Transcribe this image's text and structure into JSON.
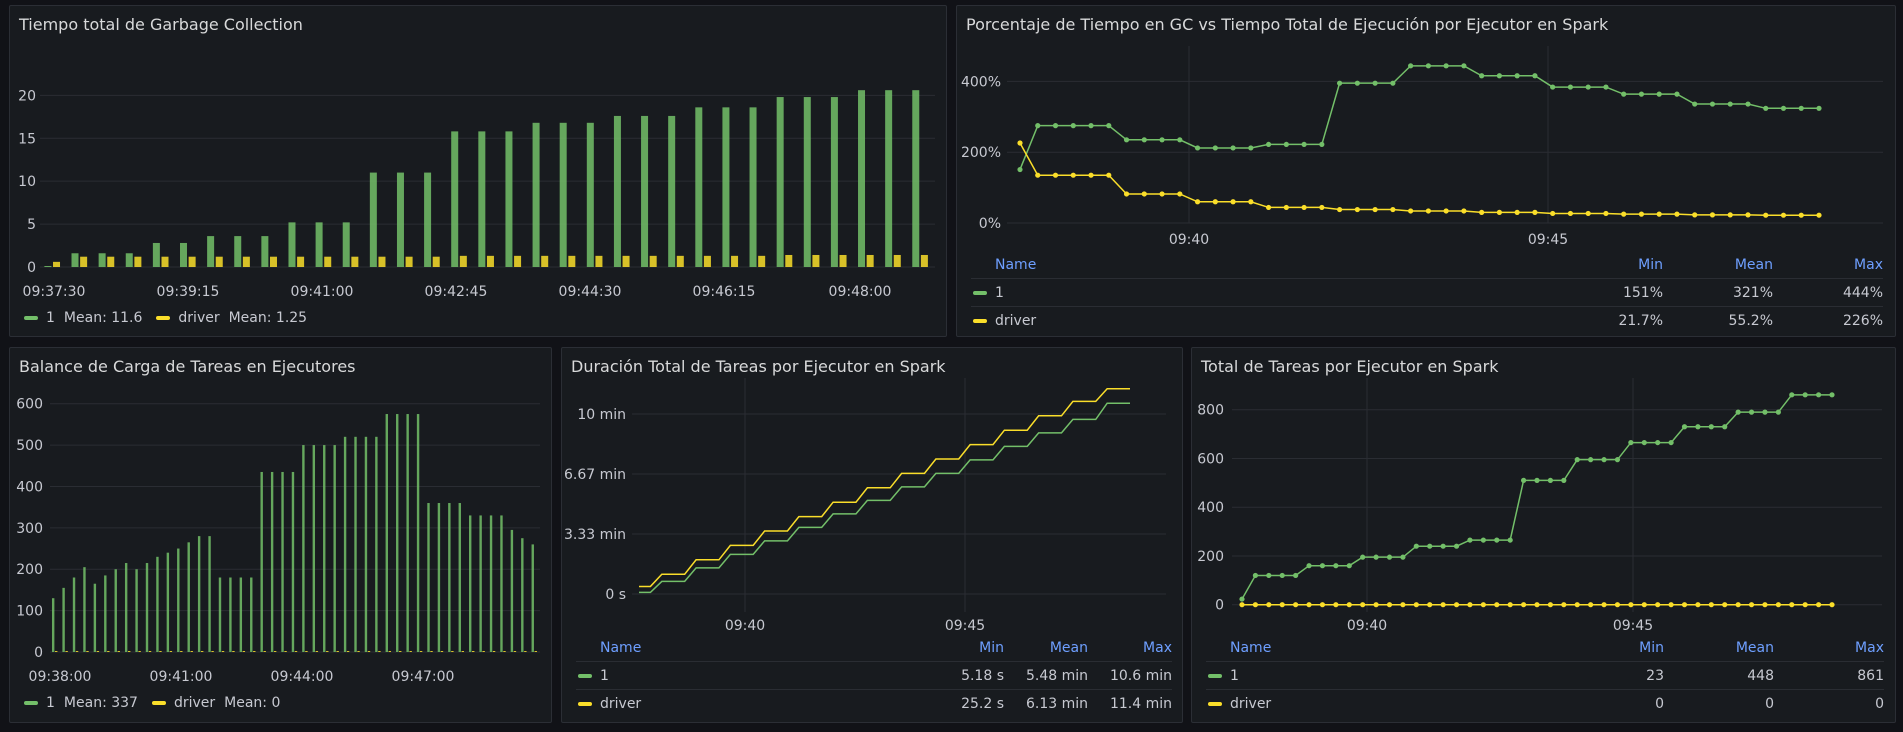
{
  "colors": {
    "green": "#73bf69",
    "yellow": "#fade2a",
    "axis_text": "#c7c9d1",
    "link_blue": "#6e9fff"
  },
  "panels": {
    "gc_time": {
      "title": "Tiempo total de Garbage Collection",
      "legend": [
        {
          "name": "1",
          "label": "Mean: 11.6",
          "color": "#73bf69"
        },
        {
          "name": "driver",
          "label": "Mean: 1.25",
          "color": "#fade2a"
        }
      ],
      "chart_data": {
        "type": "bar",
        "x_ticks": [
          "09:37:30",
          "09:39:15",
          "09:41:00",
          "09:42:45",
          "09:44:30",
          "09:46:15",
          "09:48:00"
        ],
        "y_ticks": [
          "0",
          "5",
          "10",
          "15",
          "20"
        ],
        "ylim": [
          0,
          24
        ],
        "series": [
          {
            "name": "1",
            "values": [
              0.1,
              1.6,
              1.6,
              1.6,
              2.8,
              2.8,
              3.6,
              3.6,
              3.6,
              5.2,
              5.2,
              5.2,
              11,
              11,
              11,
              15.8,
              15.8,
              15.8,
              16.8,
              16.8,
              16.8,
              17.6,
              17.6,
              17.6,
              18.6,
              18.6,
              18.6,
              19.8,
              19.8,
              19.8,
              20.6,
              20.6,
              20.6
            ]
          },
          {
            "name": "driver",
            "values": [
              0.6,
              1.2,
              1.2,
              1.2,
              1.2,
              1.2,
              1.2,
              1.2,
              1.2,
              1.2,
              1.2,
              1.2,
              1.2,
              1.2,
              1.2,
              1.3,
              1.3,
              1.3,
              1.3,
              1.3,
              1.3,
              1.3,
              1.3,
              1.3,
              1.3,
              1.3,
              1.3,
              1.4,
              1.4,
              1.4,
              1.4,
              1.4,
              1.4
            ]
          }
        ]
      }
    },
    "gc_percent": {
      "title": "Porcentaje de Tiempo en GC vs Tiempo Total de Ejecución por Ejecutor en Spark",
      "table_headers": {
        "name": "Name",
        "min": "Min",
        "mean": "Mean",
        "max": "Max"
      },
      "rows": [
        {
          "name": "1",
          "min": "151%",
          "mean": "321%",
          "max": "444%",
          "color": "#73bf69"
        },
        {
          "name": "driver",
          "min": "21.7%",
          "mean": "55.2%",
          "max": "226%",
          "color": "#fade2a"
        }
      ],
      "chart_data": {
        "type": "line",
        "x_ticks": [
          "09:40",
          "09:45"
        ],
        "y_ticks": [
          "0%",
          "200%",
          "400%"
        ],
        "ylim": [
          0,
          500
        ],
        "series": [
          {
            "name": "1",
            "values": [
              151,
              275,
              275,
              275,
              275,
              275,
              235,
              235,
              235,
              235,
              212,
              212,
              212,
              212,
              222,
              222,
              222,
              222,
              395,
              395,
              395,
              395,
              444,
              444,
              444,
              444,
              416,
              416,
              416,
              416,
              384,
              384,
              384,
              384,
              364,
              364,
              364,
              364,
              336,
              336,
              336,
              336,
              324,
              324,
              324,
              324
            ]
          },
          {
            "name": "driver",
            "values": [
              226,
              135,
              135,
              135,
              135,
              135,
              82,
              82,
              82,
              82,
              60,
              60,
              60,
              60,
              44,
              44,
              44,
              44,
              38,
              38,
              38,
              38,
              34,
              34,
              34,
              34,
              30,
              30,
              30,
              30,
              27,
              27,
              27,
              27,
              25,
              25,
              25,
              25,
              23,
              23,
              23,
              23,
              22,
              22,
              22,
              22
            ]
          }
        ]
      }
    },
    "load_balance": {
      "title": "Balance de Carga de Tareas en Ejecutores",
      "legend": [
        {
          "name": "1",
          "label": "Mean: 337",
          "color": "#73bf69"
        },
        {
          "name": "driver",
          "label": "Mean: 0",
          "color": "#fade2a"
        }
      ],
      "chart_data": {
        "type": "bar",
        "x_ticks": [
          "09:38:00",
          "09:41:00",
          "09:44:00",
          "09:47:00"
        ],
        "y_ticks": [
          "0",
          "100",
          "200",
          "300",
          "400",
          "500",
          "600"
        ],
        "ylim": [
          0,
          650
        ],
        "series": [
          {
            "name": "1",
            "values": [
              130,
              155,
              180,
              205,
              165,
              185,
              200,
              215,
              200,
              215,
              230,
              240,
              250,
              265,
              280,
              280,
              180,
              180,
              180,
              180,
              435,
              435,
              435,
              435,
              500,
              500,
              500,
              500,
              520,
              520,
              520,
              520,
              575,
              575,
              575,
              575,
              360,
              360,
              360,
              360,
              330,
              330,
              330,
              330,
              295,
              275,
              260
            ]
          },
          {
            "name": "driver",
            "values": [
              0,
              0,
              0,
              0,
              0,
              0,
              0,
              0,
              0,
              0,
              0,
              0,
              0,
              0,
              0,
              0,
              0,
              0,
              0,
              0,
              0,
              0,
              0,
              0,
              0,
              0,
              0,
              0,
              0,
              0,
              0,
              0,
              0,
              0,
              0,
              0,
              0,
              0,
              0,
              0,
              0,
              0,
              0,
              0,
              0,
              0,
              0
            ]
          }
        ]
      }
    },
    "task_duration": {
      "title": "Duración Total de Tareas por Ejecutor en Spark",
      "table_headers": {
        "name": "Name",
        "min": "Min",
        "mean": "Mean",
        "max": "Max"
      },
      "rows": [
        {
          "name": "1",
          "min": "5.18 s",
          "mean": "5.48 min",
          "max": "10.6 min",
          "color": "#73bf69"
        },
        {
          "name": "driver",
          "min": "25.2 s",
          "mean": "6.13 min",
          "max": "11.4 min",
          "color": "#fade2a"
        }
      ],
      "chart_data": {
        "type": "line",
        "x_ticks": [
          "09:40",
          "09:45"
        ],
        "y_ticks": [
          "0 s",
          "3.33 min",
          "6.67 min",
          "10 min"
        ],
        "ylim": [
          -1,
          12
        ],
        "series": [
          {
            "name": "1",
            "values": [
              0.09,
              0.09,
              0.7,
              0.7,
              0.7,
              1.45,
              1.45,
              1.45,
              2.2,
              2.2,
              2.2,
              2.95,
              2.95,
              2.95,
              3.7,
              3.7,
              3.7,
              4.45,
              4.45,
              4.45,
              5.2,
              5.2,
              5.2,
              5.95,
              5.95,
              5.95,
              6.7,
              6.7,
              6.7,
              7.45,
              7.45,
              7.45,
              8.2,
              8.2,
              8.2,
              8.95,
              8.95,
              8.95,
              9.7,
              9.7,
              9.7,
              10.6,
              10.6,
              10.6
            ]
          },
          {
            "name": "driver",
            "values": [
              0.42,
              0.42,
              1.1,
              1.1,
              1.1,
              1.9,
              1.9,
              1.9,
              2.7,
              2.7,
              2.7,
              3.5,
              3.5,
              3.5,
              4.3,
              4.3,
              4.3,
              5.1,
              5.1,
              5.1,
              5.9,
              5.9,
              5.9,
              6.7,
              6.7,
              6.7,
              7.5,
              7.5,
              7.5,
              8.3,
              8.3,
              8.3,
              9.1,
              9.1,
              9.1,
              9.9,
              9.9,
              9.9,
              10.7,
              10.7,
              10.7,
              11.4,
              11.4,
              11.4
            ]
          }
        ]
      }
    },
    "task_total": {
      "title": "Total de Tareas por Ejecutor en Spark",
      "table_headers": {
        "name": "Name",
        "min": "Min",
        "mean": "Mean",
        "max": "Max"
      },
      "rows": [
        {
          "name": "1",
          "min": "23",
          "mean": "448",
          "max": "861",
          "color": "#73bf69"
        },
        {
          "name": "driver",
          "min": "0",
          "mean": "0",
          "max": "0",
          "color": "#fade2a"
        }
      ],
      "chart_data": {
        "type": "line",
        "x_ticks": [
          "09:40",
          "09:45"
        ],
        "y_ticks": [
          "0",
          "200",
          "400",
          "600",
          "800"
        ],
        "ylim": [
          -30,
          930
        ],
        "series": [
          {
            "name": "1",
            "values": [
              23,
              120,
              120,
              120,
              120,
              160,
              160,
              160,
              160,
              195,
              195,
              195,
              195,
              240,
              240,
              240,
              240,
              265,
              265,
              265,
              265,
              510,
              510,
              510,
              510,
              595,
              595,
              595,
              595,
              665,
              665,
              665,
              665,
              730,
              730,
              730,
              730,
              790,
              790,
              790,
              790,
              861,
              861,
              861,
              861
            ]
          },
          {
            "name": "driver",
            "values": [
              0,
              0,
              0,
              0,
              0,
              0,
              0,
              0,
              0,
              0,
              0,
              0,
              0,
              0,
              0,
              0,
              0,
              0,
              0,
              0,
              0,
              0,
              0,
              0,
              0,
              0,
              0,
              0,
              0,
              0,
              0,
              0,
              0,
              0,
              0,
              0,
              0,
              0,
              0,
              0,
              0,
              0,
              0,
              0,
              0
            ]
          }
        ]
      }
    }
  }
}
